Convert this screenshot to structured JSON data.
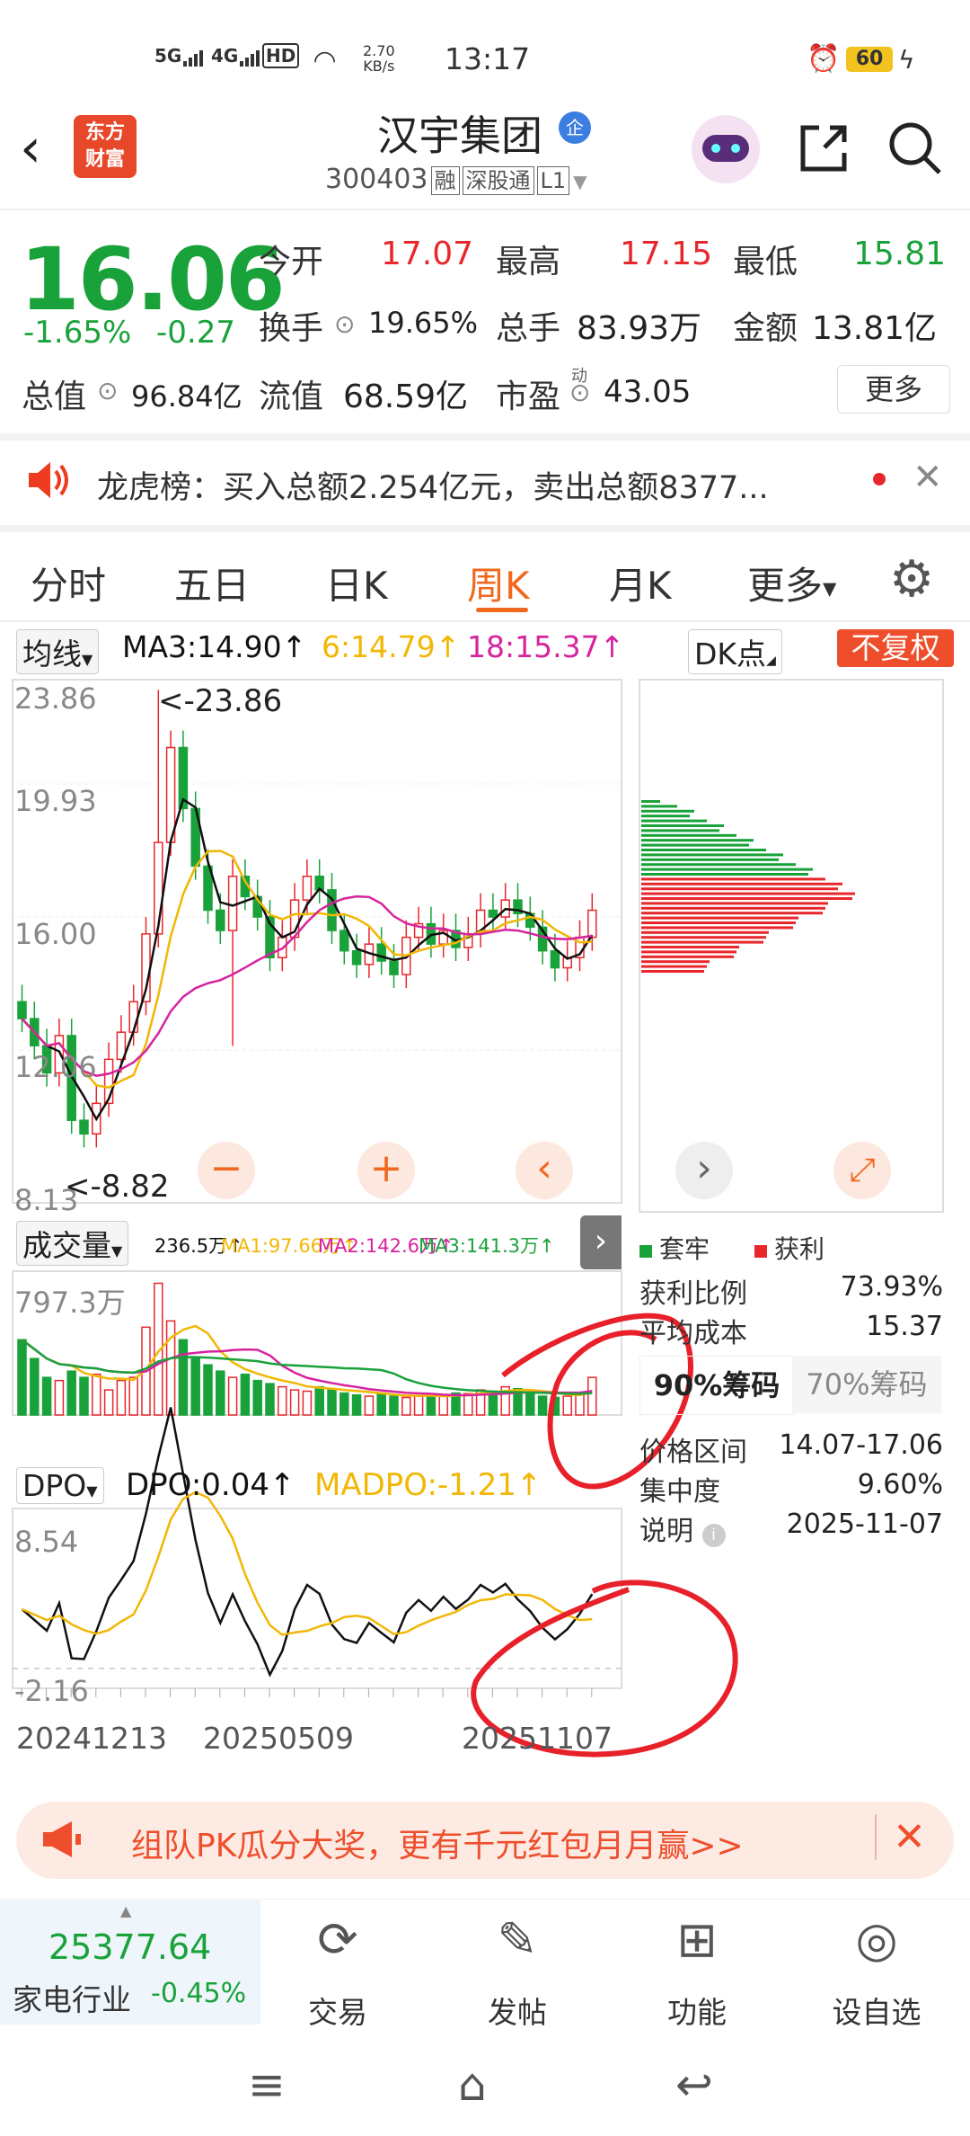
{
  "status": {
    "net1": "5G",
    "net2": "4G",
    "hd": "HD",
    "speed_val": "2.70",
    "speed_unit": "KB/s",
    "time": "13:17",
    "battery": "60"
  },
  "header": {
    "title": "汉宇集团",
    "badge": "企",
    "code": "300403",
    "tag1": "融",
    "tag2": "深股通",
    "tag3": "L1",
    "logo_line1": "东方",
    "logo_line2": "财富"
  },
  "quote": {
    "price": "16.06",
    "change_pct": "-1.65%",
    "change_abs": "-0.27",
    "open_label": "今开",
    "open": "17.07",
    "high_label": "最高",
    "high": "17.15",
    "low_label": "最低",
    "low": "15.81",
    "turnover_label": "换手",
    "turnover": "19.65%",
    "volume_label": "总手",
    "volume": "83.93万",
    "amount_label": "金额",
    "amount": "13.81亿",
    "mktcap_label": "总值",
    "mktcap": "96.84亿",
    "float_label": "流值",
    "float": "68.59亿",
    "pe_label": "市盈",
    "pe_sup": "动",
    "pe": "43.05",
    "more": "更多"
  },
  "notice": {
    "text": "龙虎榜：买入总额2.254亿元，卖出总额8377..."
  },
  "tabs": [
    "分时",
    "五日",
    "日K",
    "周K",
    "月K",
    "更多"
  ],
  "active_tab": "周K",
  "ma": {
    "selector": "均线",
    "ma3": "MA3:14.90↑",
    "ma6": "6:14.79↑",
    "ma18": "18:15.37↑",
    "dk": "DK点",
    "fq": "不复权"
  },
  "kchart": {
    "top_price": "23.86",
    "p2": "19.93",
    "p3": "16.00",
    "p4": "12.06",
    "bottom_price": "8.13",
    "max_marker": "<-23.86",
    "min_marker": "<-8.82"
  },
  "volume": {
    "selector": "成交量",
    "v": "236.5万↑",
    "ma1": "MA1:97.66万↑",
    "ma2": "MA2:142.6万↑",
    "ma3": "MA3:141.3万↑",
    "max": "797.3万"
  },
  "dpo": {
    "selector": "DPO",
    "dpo": "DPO:0.04↑",
    "madpo": "MADPO:-1.21↑",
    "top": "8.54",
    "bottom": "-2.16"
  },
  "dates": [
    "20241213",
    "20250509",
    "20251107"
  ],
  "chip": {
    "legend_trap": "套牢",
    "legend_profit": "获利",
    "profit_ratio_label": "获利比例",
    "profit_ratio": "73.93%",
    "avg_cost_label": "平均成本",
    "avg_cost": "15.37",
    "tab90": "90%筹码",
    "tab70": "70%筹码",
    "range_label": "价格区间",
    "range": "14.07-17.06",
    "conc_label": "集中度",
    "conc": "9.60%",
    "note_label": "说明",
    "note_date": "2025-11-07"
  },
  "banner": {
    "text": "组队PK瓜分大奖，更有千元红包月月赢>>"
  },
  "bottom": {
    "index_value": "25377.64",
    "index_name": "家电行业",
    "index_chg": "-0.45%",
    "trade": "交易",
    "post": "发帖",
    "func": "功能",
    "watch": "设自选"
  },
  "colors": {
    "up": "#e8272c",
    "down": "#1aa23a",
    "accent": "#f0681e",
    "ma3": "#111111",
    "ma6": "#f2b705",
    "ma18": "#d6249f"
  }
}
